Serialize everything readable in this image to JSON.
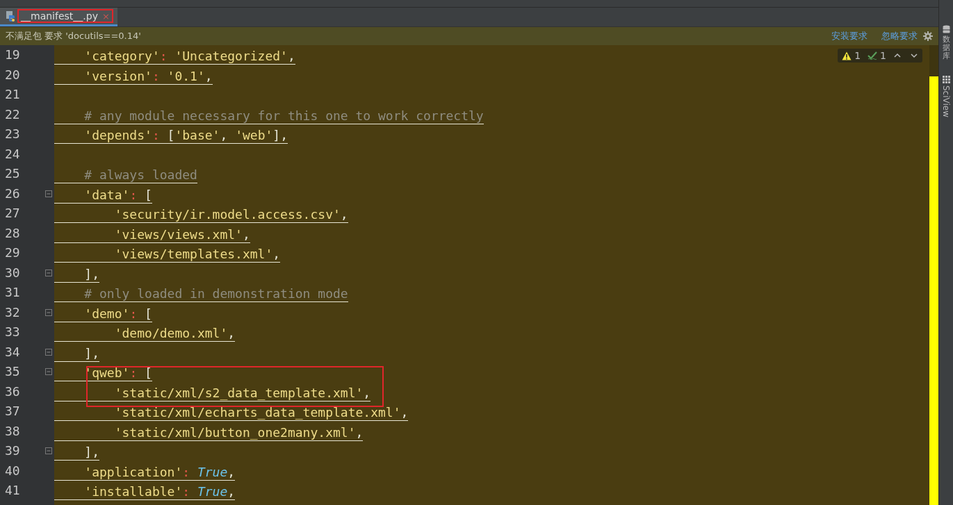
{
  "tabs": [
    {
      "label": "__manifest__.py",
      "close": "×",
      "selected": true,
      "outlined": true
    }
  ],
  "notice": {
    "message": "不满足包 要求 'docutils==0.14'",
    "actions": [
      "安装要求",
      "忽略要求"
    ]
  },
  "inspections": {
    "warnings": "1",
    "weak_warnings": "1"
  },
  "side_tools": [
    {
      "kind": "database",
      "label": "数据库"
    },
    {
      "kind": "grid",
      "label": "SciView"
    }
  ],
  "lines": [
    {
      "number": "19",
      "fold": false,
      "boxed": false,
      "tokens": [
        {
          "kind": "string",
          "text": "    'category'"
        },
        {
          "kind": "colon",
          "text": ": "
        },
        {
          "kind": "string",
          "text": "'Uncategorized'"
        },
        {
          "kind": "punct",
          "text": ","
        }
      ]
    },
    {
      "number": "20",
      "fold": false,
      "boxed": false,
      "tokens": [
        {
          "kind": "string",
          "text": "    'version'"
        },
        {
          "kind": "colon",
          "text": ": "
        },
        {
          "kind": "string",
          "text": "'0.1'"
        },
        {
          "kind": "punct",
          "text": ","
        }
      ]
    },
    {
      "number": "21",
      "fold": false,
      "boxed": false
    },
    {
      "number": "22",
      "fold": false,
      "boxed": false,
      "tokens": [
        {
          "kind": "comment",
          "text": "    # any module necessary for this one to work correctly"
        }
      ]
    },
    {
      "number": "23",
      "fold": false,
      "boxed": false,
      "tokens": [
        {
          "kind": "string",
          "text": "    'depends'"
        },
        {
          "kind": "colon",
          "text": ": "
        },
        {
          "kind": "punct",
          "text": "["
        },
        {
          "kind": "string",
          "text": "'base'"
        },
        {
          "kind": "punct",
          "text": ", "
        },
        {
          "kind": "string",
          "text": "'web'"
        },
        {
          "kind": "punct",
          "text": "],"
        }
      ]
    },
    {
      "number": "24",
      "fold": false,
      "boxed": false
    },
    {
      "number": "25",
      "fold": false,
      "boxed": false,
      "tokens": [
        {
          "kind": "comment",
          "text": "    # always loaded"
        }
      ]
    },
    {
      "number": "26",
      "fold": true,
      "boxed": false,
      "tokens": [
        {
          "kind": "string",
          "text": "    'data'"
        },
        {
          "kind": "colon",
          "text": ": "
        },
        {
          "kind": "punct",
          "text": "["
        }
      ]
    },
    {
      "number": "27",
      "fold": false,
      "boxed": false,
      "tokens": [
        {
          "kind": "string",
          "text": "        'security/ir.model.access.csv'"
        },
        {
          "kind": "punct",
          "text": ","
        }
      ]
    },
    {
      "number": "28",
      "fold": false,
      "boxed": false,
      "tokens": [
        {
          "kind": "string",
          "text": "        'views/views.xml'"
        },
        {
          "kind": "punct",
          "text": ","
        }
      ]
    },
    {
      "number": "29",
      "fold": false,
      "boxed": false,
      "tokens": [
        {
          "kind": "string",
          "text": "        'views/templates.xml'"
        },
        {
          "kind": "punct",
          "text": ","
        }
      ]
    },
    {
      "number": "30",
      "fold": true,
      "boxed": false,
      "tokens": [
        {
          "kind": "punct",
          "text": "    ],"
        }
      ]
    },
    {
      "number": "31",
      "fold": false,
      "boxed": false,
      "tokens": [
        {
          "kind": "comment",
          "text": "    # only loaded in demonstration mode"
        }
      ]
    },
    {
      "number": "32",
      "fold": true,
      "boxed": false,
      "tokens": [
        {
          "kind": "string",
          "text": "    'demo'"
        },
        {
          "kind": "colon",
          "text": ": "
        },
        {
          "kind": "punct",
          "text": "["
        }
      ]
    },
    {
      "number": "33",
      "fold": false,
      "boxed": false,
      "tokens": [
        {
          "kind": "string",
          "text": "        'demo/demo.xml'"
        },
        {
          "kind": "punct",
          "text": ","
        }
      ]
    },
    {
      "number": "34",
      "fold": true,
      "boxed": false,
      "tokens": [
        {
          "kind": "punct",
          "text": "    ],"
        }
      ]
    },
    {
      "number": "35",
      "fold": true,
      "boxed": true,
      "tokens": [
        {
          "kind": "string",
          "text": "    'qweb'"
        },
        {
          "kind": "colon",
          "text": ": "
        },
        {
          "kind": "punct",
          "text": "["
        }
      ]
    },
    {
      "number": "36",
      "fold": false,
      "boxed": true,
      "tokens": [
        {
          "kind": "string",
          "text": "        'static/xml/s2_data_template.xml'"
        },
        {
          "kind": "punct",
          "text": ","
        }
      ]
    },
    {
      "number": "37",
      "fold": false,
      "boxed": false,
      "tokens": [
        {
          "kind": "string",
          "text": "        'static/xml/echarts_data_template.xml'"
        },
        {
          "kind": "punct",
          "text": ","
        }
      ]
    },
    {
      "number": "38",
      "fold": false,
      "boxed": false,
      "tokens": [
        {
          "kind": "string",
          "text": "        'static/xml/button_one2many.xml'"
        },
        {
          "kind": "punct",
          "text": ","
        }
      ]
    },
    {
      "number": "39",
      "fold": true,
      "boxed": false,
      "tokens": [
        {
          "kind": "punct",
          "text": "    ],"
        }
      ]
    },
    {
      "number": "40",
      "fold": false,
      "boxed": false,
      "tokens": [
        {
          "kind": "string",
          "text": "    'application'"
        },
        {
          "kind": "colon",
          "text": ": "
        },
        {
          "kind": "keyword",
          "text": "True"
        },
        {
          "kind": "punct",
          "text": ","
        }
      ]
    },
    {
      "number": "41",
      "fold": false,
      "boxed": false,
      "tokens": [
        {
          "kind": "string",
          "text": "    'installable'"
        },
        {
          "kind": "colon",
          "text": ": "
        },
        {
          "kind": "keyword",
          "text": "True"
        },
        {
          "kind": "punct",
          "text": ","
        }
      ]
    }
  ]
}
